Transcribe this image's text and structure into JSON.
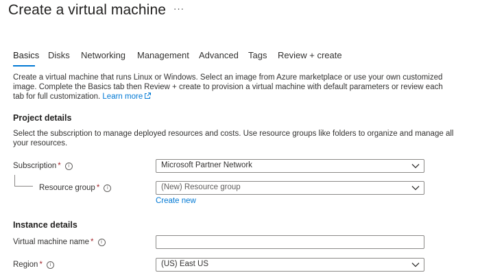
{
  "header": {
    "title": "Create a virtual machine",
    "more_label": "···"
  },
  "tabs": [
    {
      "label": "Basics",
      "active": true
    },
    {
      "label": "Disks"
    },
    {
      "label": "Networking"
    },
    {
      "label": "Management"
    },
    {
      "label": "Advanced"
    },
    {
      "label": "Tags"
    },
    {
      "label": "Review + create"
    }
  ],
  "intro": {
    "line1": "Create a virtual machine that runs Linux or Windows. Select an image from Azure marketplace or use your own customized",
    "line2": "image. Complete the Basics tab then Review + create to provision a virtual machine with default parameters or review each",
    "line3": "tab for full customization.",
    "learn_more": "Learn more"
  },
  "project_details": {
    "heading": "Project details",
    "desc_line1": "Select the subscription to manage deployed resources and costs. Use resource groups like folders to organize and manage all",
    "desc_line2": "your resources.",
    "subscription_label": "Subscription",
    "subscription_value": "Microsoft Partner Network",
    "resource_group_label": "Resource group",
    "resource_group_value": "(New) Resource group",
    "create_new": "Create new"
  },
  "instance_details": {
    "heading": "Instance details",
    "vm_name_label": "Virtual machine name",
    "vm_name_value": "",
    "region_label": "Region",
    "region_value": "(US) East US"
  },
  "required_marker": "*",
  "info_glyph": "i",
  "colors": {
    "accent": "#0078d4",
    "required": "#a4262c",
    "text": "#323130",
    "border": "#8a8886"
  }
}
